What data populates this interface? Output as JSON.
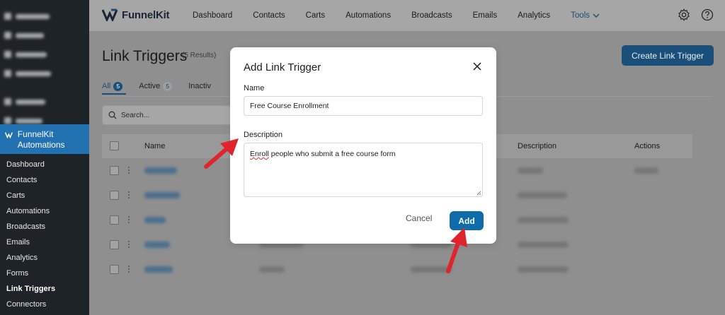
{
  "sidebar": {
    "active_app": "FunnelKit Automations",
    "submenu": [
      "Dashboard",
      "Contacts",
      "Carts",
      "Automations",
      "Broadcasts",
      "Emails",
      "Analytics",
      "Forms",
      "Link Triggers",
      "Connectors"
    ],
    "current": "Link Triggers"
  },
  "topnav": {
    "brand": "FunnelKit",
    "items": [
      "Dashboard",
      "Contacts",
      "Carts",
      "Automations",
      "Broadcasts",
      "Emails",
      "Analytics"
    ],
    "tools_label": "Tools",
    "icons": [
      "settings-icon",
      "help-icon"
    ]
  },
  "page": {
    "title": "Link Triggers",
    "count": "(5 Results)",
    "create_button": "Create Link Trigger",
    "tabs": [
      {
        "label": "All",
        "count": "5"
      },
      {
        "label": "Active",
        "count": "5"
      },
      {
        "label": "Inactiv",
        "count": ""
      }
    ],
    "search_placeholder": "Search...",
    "columns": [
      "Name",
      "Description",
      "Actions"
    ],
    "row_count": 5
  },
  "modal": {
    "title": "Add Link Trigger",
    "name_label": "Name",
    "name_value": "Free Course Enrollment",
    "description_label": "Description",
    "description_value_first": "Enroll",
    "description_value_rest": " people who submit a free course form",
    "cancel_label": "Cancel",
    "add_label": "Add"
  },
  "colors": {
    "primary": "#0f6ca8",
    "annotation_arrow": "#e0242b",
    "wp_admin_bar": "#1d2327",
    "wp_active": "#2271b1"
  }
}
